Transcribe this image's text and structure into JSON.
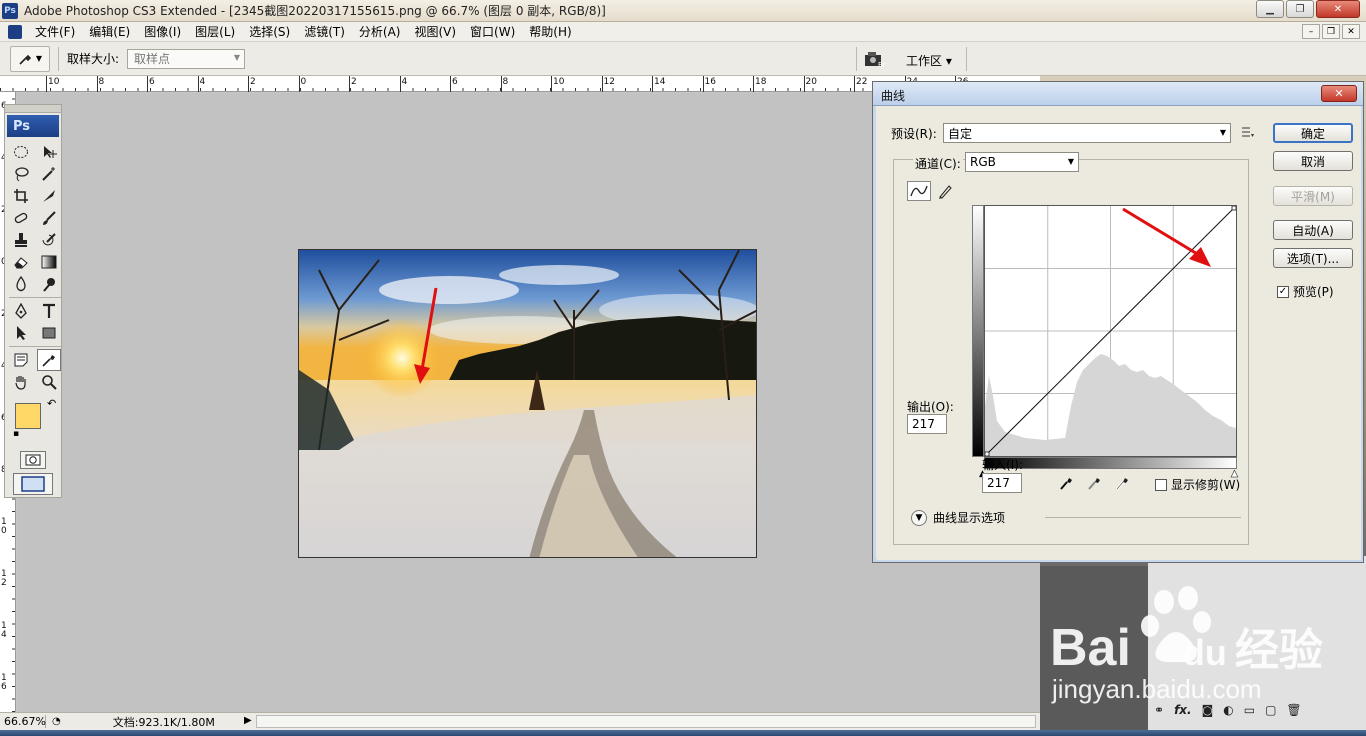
{
  "window": {
    "title": "Adobe Photoshop CS3 Extended - [2345截图20220317155615.png @ 66.7% (图层 0 副本, RGB/8)]",
    "app_icon": "Ps"
  },
  "menu": {
    "items": [
      "文件(F)",
      "编辑(E)",
      "图像(I)",
      "图层(L)",
      "选择(S)",
      "滤镜(T)",
      "分析(A)",
      "视图(V)",
      "窗口(W)",
      "帮助(H)"
    ]
  },
  "options": {
    "sample_size_label": "取样大小:",
    "sample_size_value": "取样点",
    "workspace_label": "工作区 ▾"
  },
  "ruler": {
    "h_labels": [
      "10",
      "8",
      "6",
      "4",
      "2",
      "0",
      "2",
      "4",
      "6",
      "8",
      "10",
      "12",
      "14",
      "16",
      "18",
      "20",
      "22",
      "24",
      "26"
    ],
    "v_labels": [
      "6",
      "4",
      "2",
      "0",
      "2",
      "4",
      "6",
      "8",
      "10",
      "12",
      "14",
      "16",
      "18"
    ]
  },
  "toolbox": {
    "badge": "Ps",
    "foreground_color": "#ffd868",
    "background_color": "#ffffff"
  },
  "status": {
    "zoom": "66.67%",
    "doc_info": "文档:923.1K/1.80M"
  },
  "curves_dialog": {
    "title": "曲线",
    "preset_label": "预设(R):",
    "preset_value": "自定",
    "channel_label": "通道(C):",
    "channel_value": "RGB",
    "output_label": "输出(O):",
    "output_value": "217",
    "input_label": "输入(I):",
    "input_value": "217",
    "show_clipping_label": "显示修剪(W)",
    "show_clipping_checked": false,
    "display_options_label": "曲线显示选项",
    "buttons": {
      "ok": "确定",
      "cancel": "取消",
      "smooth": "平滑(M)",
      "auto": "自动(A)",
      "options": "选项(T)..."
    },
    "preview_label": "预览(P)",
    "preview_checked": true
  },
  "layers_panel": {
    "fx_label": "fx."
  },
  "watermark": {
    "brand": "Bai",
    "brand2": "du",
    "cn": "经验",
    "url": "jingyan.baidu.com"
  },
  "colors": {
    "annotation_arrow": "#e01010",
    "ps_blue": "#1c3f84",
    "canvas_bg": "#c2c2c2"
  }
}
